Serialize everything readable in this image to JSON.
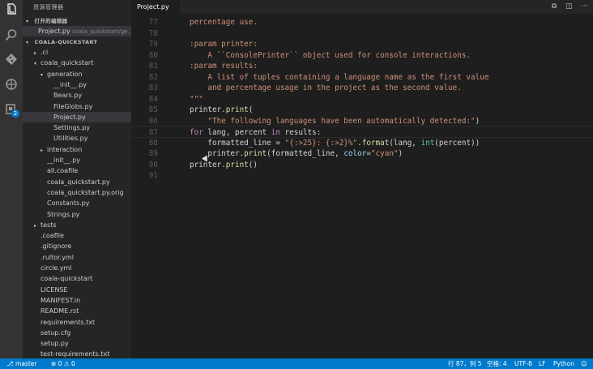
{
  "sidebar": {
    "title": "资源管理器",
    "open_editors_header": "打开的编辑器",
    "open_file": "Project.py",
    "open_file_desc": "coala_quickstart/ge...",
    "project_header": "COALA-QUICKSTART",
    "tree": [
      {
        "label": ".ci",
        "arrow": "▸"
      },
      {
        "label": "coala_quickstart",
        "arrow": "▾"
      },
      {
        "label": "generation",
        "arrow": "▾"
      },
      {
        "label": "__init__.py",
        "arrow": ""
      },
      {
        "label": "Bears.py",
        "arrow": ""
      },
      {
        "label": "FileGlobs.py",
        "arrow": ""
      },
      {
        "label": "Project.py",
        "arrow": ""
      },
      {
        "label": "Settings.py",
        "arrow": ""
      },
      {
        "label": "Utilities.py",
        "arrow": ""
      },
      {
        "label": "interaction",
        "arrow": "▸"
      },
      {
        "label": "__init__.py",
        "arrow": ""
      },
      {
        "label": "all.coafile",
        "arrow": ""
      },
      {
        "label": "coala_quickstart.py",
        "arrow": ""
      },
      {
        "label": "coala_quickstart.py.orig",
        "arrow": ""
      },
      {
        "label": "Constants.py",
        "arrow": ""
      },
      {
        "label": "Strings.py",
        "arrow": ""
      },
      {
        "label": "tests",
        "arrow": "▸"
      },
      {
        "label": ".coafile",
        "arrow": ""
      },
      {
        "label": ".gitignore",
        "arrow": ""
      },
      {
        "label": ".rultor.yml",
        "arrow": ""
      },
      {
        "label": "circle.yml",
        "arrow": ""
      },
      {
        "label": "coala-quickstart",
        "arrow": ""
      },
      {
        "label": "LICENSE",
        "arrow": ""
      },
      {
        "label": "MANIFEST.in",
        "arrow": ""
      },
      {
        "label": "README.rst",
        "arrow": ""
      },
      {
        "label": "requirements.txt",
        "arrow": ""
      },
      {
        "label": "setup.cfg",
        "arrow": ""
      },
      {
        "label": "setup.py",
        "arrow": ""
      },
      {
        "label": "test-requirements.txt",
        "arrow": ""
      }
    ]
  },
  "activity": {
    "badge": "2",
    "icons": [
      "files-icon",
      "search-icon",
      "git-icon",
      "debug-icon",
      "extensions-icon"
    ]
  },
  "tab": {
    "label": "Project.py"
  },
  "editor": {
    "lines": [
      {
        "n": "77",
        "tokens": [
          {
            "c": "str",
            "t": "percentage use."
          }
        ]
      },
      {
        "n": "78",
        "tokens": []
      },
      {
        "n": "79",
        "tokens": [
          {
            "c": "str",
            "t": ":param printer:"
          }
        ]
      },
      {
        "n": "80",
        "tokens": [
          {
            "c": "str",
            "t": "    A ``ConsolePrinter`` object used for console interactions."
          }
        ]
      },
      {
        "n": "81",
        "tokens": [
          {
            "c": "str",
            "t": ":param results:"
          }
        ]
      },
      {
        "n": "82",
        "tokens": [
          {
            "c": "str",
            "t": "    A list of tuples containing a language name as the first value"
          }
        ]
      },
      {
        "n": "83",
        "tokens": [
          {
            "c": "str",
            "t": "    and percentage usage in the project as the second value."
          }
        ]
      },
      {
        "n": "84",
        "tokens": [
          {
            "c": "str",
            "t": "\"\"\""
          }
        ]
      },
      {
        "n": "85",
        "tokens": [
          {
            "c": "txt",
            "t": "printer."
          },
          {
            "c": "fn",
            "t": "print"
          },
          {
            "c": "txt",
            "t": "("
          }
        ]
      },
      {
        "n": "86",
        "tokens": [
          {
            "c": "str",
            "t": "    \"The following languages have been automatically detected:\""
          },
          {
            "c": "txt",
            "t": ")"
          }
        ]
      },
      {
        "n": "87",
        "tokens": [
          {
            "c": "kw",
            "t": "for"
          },
          {
            "c": "txt",
            "t": " lang, percent "
          },
          {
            "c": "kw",
            "t": "in"
          },
          {
            "c": "txt",
            "t": " results:"
          }
        ]
      },
      {
        "n": "88",
        "tokens": [
          {
            "c": "txt",
            "t": "    formatted_line = "
          },
          {
            "c": "str",
            "t": "\"{:>25}: {:>2}%\""
          },
          {
            "c": "txt",
            "t": "."
          },
          {
            "c": "fn",
            "t": "format"
          },
          {
            "c": "txt",
            "t": "(lang, "
          },
          {
            "c": "bi",
            "t": "int"
          },
          {
            "c": "txt",
            "t": "(percent))"
          }
        ]
      },
      {
        "n": "89",
        "tokens": [
          {
            "c": "txt",
            "t": "    printer."
          },
          {
            "c": "fn",
            "t": "print"
          },
          {
            "c": "txt",
            "t": "(formatted_line, "
          },
          {
            "c": "par",
            "t": "color"
          },
          {
            "c": "txt",
            "t": "="
          },
          {
            "c": "str",
            "t": "\"cyan\""
          },
          {
            "c": "txt",
            "t": ")"
          }
        ]
      },
      {
        "n": "90",
        "tokens": [
          {
            "c": "txt",
            "t": "printer."
          },
          {
            "c": "fn",
            "t": "print"
          },
          {
            "c": "txt",
            "t": "()"
          }
        ]
      },
      {
        "n": "91",
        "tokens": []
      }
    ],
    "current_line": "87"
  },
  "status": {
    "branch": "master",
    "errors": "0",
    "warnings": "0",
    "position": "行 87，列 5",
    "spaces": "空格: 4",
    "encoding": "UTF-8",
    "eol": "LF",
    "language": "Python",
    "feedback": "☺"
  },
  "colors": {
    "accent": "#007acc",
    "string": "#ce9178",
    "keyword": "#c586c0",
    "function": "#dcdcaa"
  }
}
